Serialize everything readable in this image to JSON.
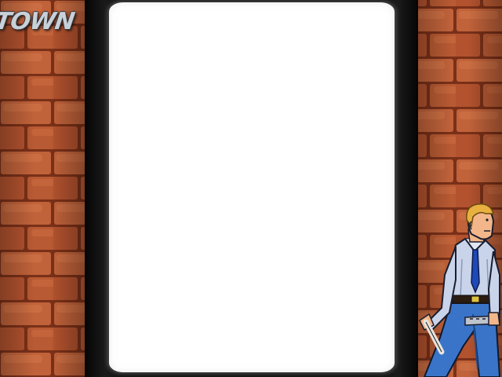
{
  "marquee": {
    "logo_text": "TOWN"
  },
  "colors": {
    "brick": "#b45a32",
    "mortar": "#8a3a20",
    "bezel": "#101010",
    "screen": "#ffffff",
    "shirt": "#c9d4ea",
    "tie": "#1f49b8",
    "pants": "#3a74c8",
    "hair": "#e8b040",
    "skin": "#f2b68a"
  },
  "character": {
    "name_icon": "brawler-with-nightstick-icon"
  }
}
